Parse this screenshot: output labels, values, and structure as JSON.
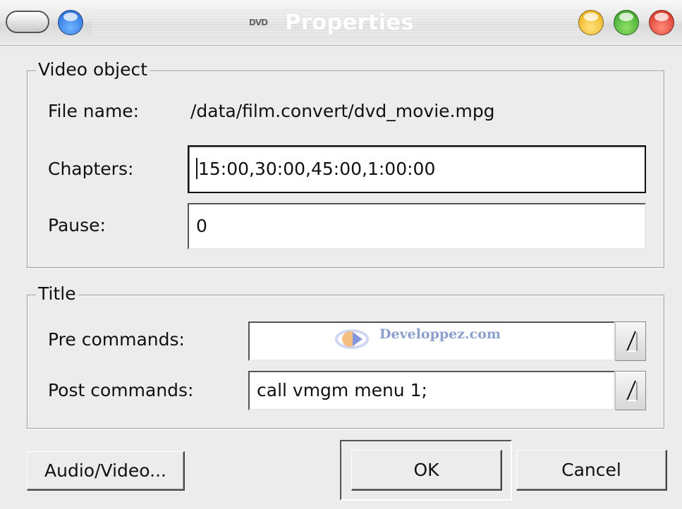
{
  "window": {
    "title": "Properties",
    "app_icon_text": "DVD"
  },
  "video_object": {
    "group_label": "Video object",
    "file_name_label": "File name:",
    "file_name_value": "/data/film.convert/dvd_movie.mpg",
    "chapters_label": "Chapters:",
    "chapters_value": "15:00,30:00,45:00,1:00:00",
    "pause_label": "Pause:",
    "pause_value": "0"
  },
  "title_group": {
    "group_label": "Title",
    "pre_commands_label": "Pre commands:",
    "pre_commands_value": "",
    "post_commands_label": "Post commands:",
    "post_commands_value": "call vmgm menu 1;"
  },
  "watermark": {
    "text": "Developpez.com"
  },
  "buttons": {
    "audio_video": "Audio/Video...",
    "ok": "OK",
    "cancel": "Cancel"
  },
  "colors": {
    "window_bg": "#ececec",
    "close_button": "#d0261a",
    "maximize_button": "#2f9a23",
    "minimize_button": "#e9a90f",
    "menu_button": "#1f62d6"
  }
}
